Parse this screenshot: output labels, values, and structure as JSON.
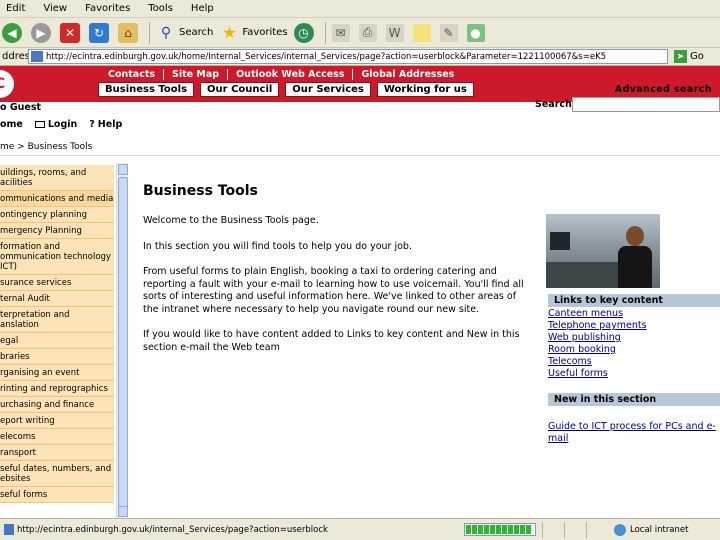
{
  "browser": {
    "menu": [
      "Edit",
      "View",
      "Favorites",
      "Tools",
      "Help"
    ],
    "toolbar": {
      "back": "",
      "forward": "",
      "search": "Search",
      "favorites": "Favorites"
    },
    "address": {
      "label": "ddress",
      "url": "http://ecintra.edinburgh.gov.uk/home/Internal_Services/internal_Services/page?action=userblock&Parameter=1221100067&s=eK5",
      "go": "Go"
    },
    "status": {
      "url": "http://ecintra.edinburgh.gov.uk/internal_Services/page?action=userblock",
      "zone": "Local intranet"
    }
  },
  "header": {
    "top_links": [
      "Contacts",
      "Site Map",
      "Outlook Web Access",
      "Global Addresses"
    ],
    "tabs": [
      "Business Tools",
      "Our Council",
      "Our Services",
      "Working for us"
    ],
    "advanced_search": "Advanced search",
    "guest": "o Guest",
    "search_label": "Search",
    "nav_links": [
      "ome",
      "Login",
      "Help"
    ],
    "breadcrumb": "me > Business Tools"
  },
  "sidebar": {
    "items": [
      "uildings, rooms, and\nacilities",
      "ommunications and media",
      "ontingency planning",
      "mergency Planning",
      "formation and\nommunication technology\nICT)",
      "surance services",
      "ternal Audit",
      "terpretation and\nanslation",
      "egal",
      "braries",
      "rganising an event",
      "rinting and reprographics",
      "urchasing and finance",
      "eport writing",
      "elecoms",
      "ransport",
      "seful dates, numbers, and\nebsites",
      "seful forms"
    ]
  },
  "main": {
    "title": "Business Tools",
    "paragraphs": [
      "Welcome to the Business Tools page.",
      "In this section you will find tools to help you do your job.",
      "From useful forms to plain English, booking a taxi to ordering catering and reporting a fault with your e-mail to learning how to use voicemail. You'll find all sorts of interesting and useful information here. We've linked to other areas of the intranet where necessary to help you navigate round our new site.",
      "If you would like to have content added to Links to key content and New in this section e-mail the Web team"
    ]
  },
  "right": {
    "key_title": "Links to key content",
    "key_links": [
      "Canteen menus",
      "Telephone payments",
      "Web publishing",
      "Room booking",
      "Telecoms",
      "Useful forms"
    ],
    "new_title": "New in this section",
    "new_links": [
      "Guide to ICT process for PCs and e-",
      "mail"
    ]
  }
}
